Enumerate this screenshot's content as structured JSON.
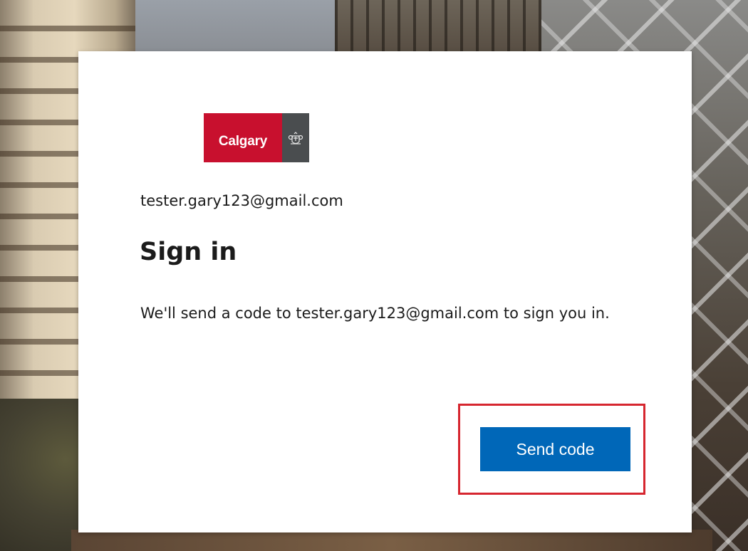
{
  "brand": {
    "logo_text": "Calgary",
    "logo_color": "#c8102e",
    "crest_color": "#4a4d4f",
    "crest_icon": "coat-of-arms-icon"
  },
  "signin": {
    "account": "tester.gary123@gmail.com",
    "title": "Sign in",
    "description": "We'll send a code to tester.gary123@gmail.com to sign you in.",
    "send_button_label": "Send code",
    "button_color": "#0067b8",
    "highlight_color": "#d6262f"
  }
}
